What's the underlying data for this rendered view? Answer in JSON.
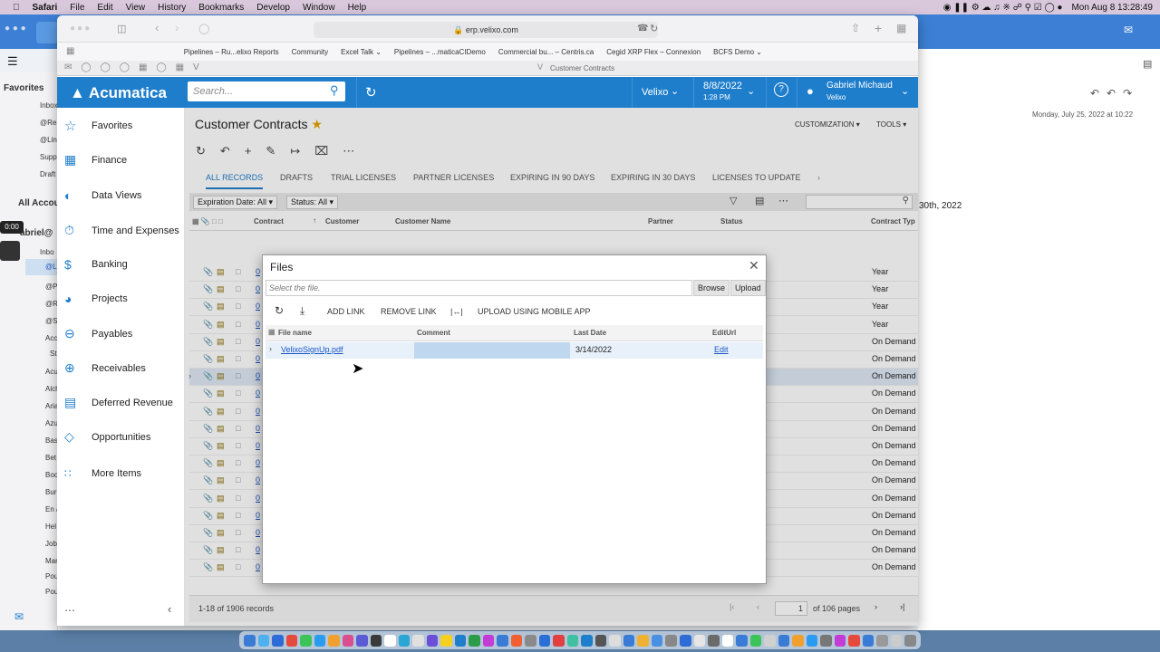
{
  "menubar": {
    "apple": "",
    "items": [
      "Safari",
      "File",
      "Edit",
      "View",
      "History",
      "Bookmarks",
      "Develop",
      "Window",
      "Help"
    ],
    "clock": "Mon Aug 8  13:28:49"
  },
  "mail": {
    "favorites": "Favorites",
    "all_accounts": "All Accou",
    "sidebar_items": [
      "Inbox",
      "@Re",
      "@Lin",
      "Supp",
      "Draft",
      "Inbo",
      "@Li",
      "@Pi",
      "@Re",
      "@Sl",
      "Acc",
      "St",
      "Acu",
      "Alch",
      "Aria",
      "Azu",
      "Bas",
      "Bet",
      "Boc",
      "Bur",
      "En a",
      "Hel",
      "Job",
      "Mar",
      "Pou",
      "Pou"
    ],
    "account_label": "abriel@",
    "rec_time": "0:00",
    "date_header": "Monday, July 25, 2022 at 10:22",
    "body_date": "30th, 2022"
  },
  "safari": {
    "url": "erp.velixo.com",
    "favorites": [
      "Pipelines – Ru...elixo Reports",
      "Community",
      "Excel Talk",
      "Pipelines – ...maticaCIDemo",
      "Commercial bu... – Centris.ca",
      "Cegid XRP Flex – Connexion",
      "BCFS Demo"
    ],
    "tab_title": "Customer Contracts"
  },
  "acumatica": {
    "logo": "Acumatica",
    "search_placeholder": "Search...",
    "company": "Velixo",
    "date": "8/8/2022",
    "time": "1:28 PM",
    "user_name": "Gabriel Michaud",
    "user_company": "Velixo",
    "menu": [
      "Favorites",
      "Finance",
      "Data Views",
      "Time and Expenses",
      "Banking",
      "Projects",
      "Payables",
      "Receivables",
      "Deferred Revenue",
      "Opportunities",
      "More Items"
    ],
    "page_title": "Customer Contracts",
    "customization": "CUSTOMIZATION",
    "tools": "TOOLS",
    "tabs": [
      "ALL RECORDS",
      "DRAFTS",
      "TRIAL LICENSES",
      "PARTNER LICENSES",
      "EXPIRING IN 90 DAYS",
      "EXPIRING IN 30 DAYS",
      "LICENSES TO UPDATE"
    ],
    "filters": [
      "Expiration Date: All",
      "Status: All"
    ],
    "columns": [
      "Contract",
      "Customer",
      "Customer Name",
      "Partner",
      "Status",
      "Contract Typ"
    ],
    "row_contract_types": [
      "Year",
      "Year",
      "Year",
      "Year",
      "On Demand",
      "On Demand",
      "On Demand",
      "On Demand",
      "On Demand",
      "On Demand",
      "On Demand",
      "On Demand",
      "On Demand",
      "On Demand",
      "On Demand",
      "On Demand",
      "On Demand",
      "On Demand"
    ],
    "row_contract": "0",
    "records": "1-18 of 1906 records",
    "page": "1",
    "of_pages": "of 106 pages"
  },
  "files_dialog": {
    "title": "Files",
    "select_placeholder": "Select the file.",
    "browse": "Browse",
    "upload": "Upload",
    "add_link": "ADD LINK",
    "remove_link": "REMOVE LINK",
    "upload_mobile": "UPLOAD USING MOBILE APP",
    "columns": [
      "File name",
      "Comment",
      "Last Date",
      "EditUrl"
    ],
    "file": {
      "name": "VelixoSignUp.pdf",
      "comment": "",
      "last_date": "3/14/2022",
      "edit": "Edit"
    }
  }
}
